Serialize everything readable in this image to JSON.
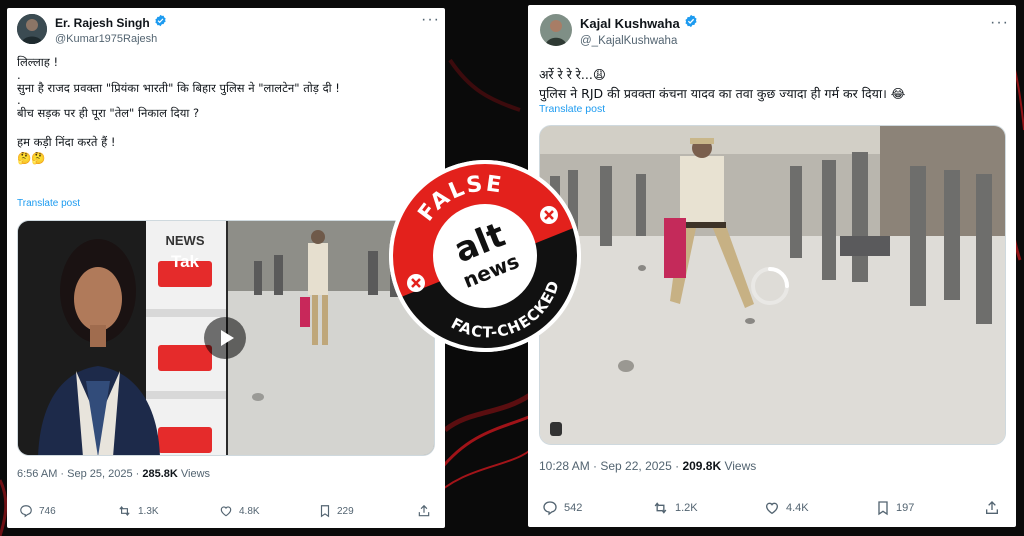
{
  "colors": {
    "accent": "#1d9bf0",
    "verified": "#1d9bf0",
    "badge_red": "#e3211c",
    "muted": "#536471"
  },
  "left_post": {
    "author_name": "Er. Rajesh Singh",
    "handle": "@Kumar1975Rajesh",
    "lines": [
      "लिल्लाह !",
      ".",
      "सुना है राजद प्रवक्ता \"प्रियंका भारती\" कि बिहार पुलिस ने \"लालटेन\" तोड़ दी !",
      ".",
      "बीच सड़क पर ही पूरा \"तेल\" निकाल दिया ?",
      "",
      "हम कड़ी निंदा करते हैं !",
      "🤔🤔"
    ],
    "translate_label": "Translate post",
    "video_logo_word1": "NEWS",
    "video_logo_word2": "Tak",
    "timestamp": "6:56 AM · Sep 25, 2025 · ",
    "views_count": "285.8K",
    "views_label": " Views",
    "actions": {
      "replies": "746",
      "reposts": "1.3K",
      "likes": "4.8K",
      "bookmarks": "229"
    }
  },
  "right_post": {
    "author_name": "Kajal Kushwaha",
    "handle": "@_KajalKushwaha",
    "lines": [
      "अर्रे रे रे रे...😩",
      "पुलिस ने RJD की प्रवक्ता कंचना यादव का तवा कुछ ज्यादा ही गर्म कर दिया। 😂"
    ],
    "translate_label": "Translate post",
    "timestamp": "10:28 AM · Sep 22, 2025 · ",
    "views_count": "209.8K",
    "views_label": " Views",
    "actions": {
      "replies": "542",
      "reposts": "1.2K",
      "likes": "4.4K",
      "bookmarks": "197"
    }
  },
  "badge": {
    "top_text": "FALSE",
    "bottom_text": "FACT-CHECKED",
    "logo_word1": "alt",
    "logo_word2": "news"
  },
  "icons": [
    "verified-icon",
    "more-icon",
    "play-icon",
    "loading-spinner-icon",
    "reply-icon",
    "repost-icon",
    "like-icon",
    "bookmark-icon",
    "share-icon",
    "x-mark-icon"
  ]
}
